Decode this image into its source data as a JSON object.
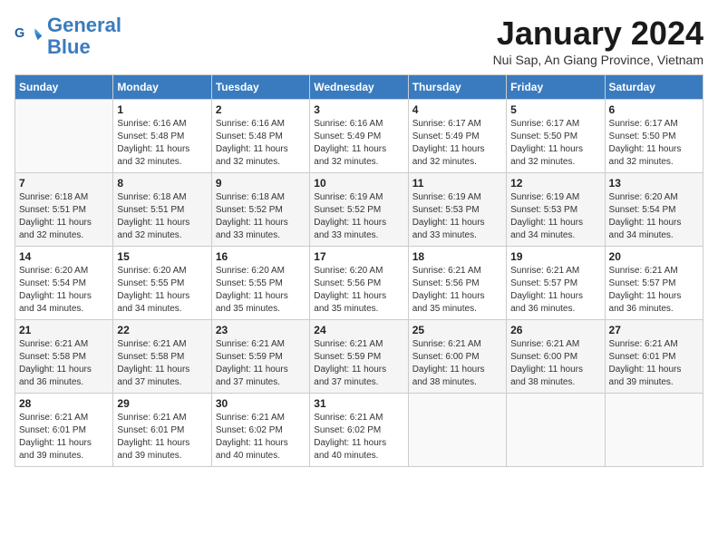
{
  "header": {
    "logo_line1": "General",
    "logo_line2": "Blue",
    "month_title": "January 2024",
    "location": "Nui Sap, An Giang Province, Vietnam"
  },
  "days_of_week": [
    "Sunday",
    "Monday",
    "Tuesday",
    "Wednesday",
    "Thursday",
    "Friday",
    "Saturday"
  ],
  "weeks": [
    [
      {
        "day": "",
        "info": ""
      },
      {
        "day": "1",
        "info": "Sunrise: 6:16 AM\nSunset: 5:48 PM\nDaylight: 11 hours\nand 32 minutes."
      },
      {
        "day": "2",
        "info": "Sunrise: 6:16 AM\nSunset: 5:48 PM\nDaylight: 11 hours\nand 32 minutes."
      },
      {
        "day": "3",
        "info": "Sunrise: 6:16 AM\nSunset: 5:49 PM\nDaylight: 11 hours\nand 32 minutes."
      },
      {
        "day": "4",
        "info": "Sunrise: 6:17 AM\nSunset: 5:49 PM\nDaylight: 11 hours\nand 32 minutes."
      },
      {
        "day": "5",
        "info": "Sunrise: 6:17 AM\nSunset: 5:50 PM\nDaylight: 11 hours\nand 32 minutes."
      },
      {
        "day": "6",
        "info": "Sunrise: 6:17 AM\nSunset: 5:50 PM\nDaylight: 11 hours\nand 32 minutes."
      }
    ],
    [
      {
        "day": "7",
        "info": "Sunrise: 6:18 AM\nSunset: 5:51 PM\nDaylight: 11 hours\nand 32 minutes."
      },
      {
        "day": "8",
        "info": "Sunrise: 6:18 AM\nSunset: 5:51 PM\nDaylight: 11 hours\nand 32 minutes."
      },
      {
        "day": "9",
        "info": "Sunrise: 6:18 AM\nSunset: 5:52 PM\nDaylight: 11 hours\nand 33 minutes."
      },
      {
        "day": "10",
        "info": "Sunrise: 6:19 AM\nSunset: 5:52 PM\nDaylight: 11 hours\nand 33 minutes."
      },
      {
        "day": "11",
        "info": "Sunrise: 6:19 AM\nSunset: 5:53 PM\nDaylight: 11 hours\nand 33 minutes."
      },
      {
        "day": "12",
        "info": "Sunrise: 6:19 AM\nSunset: 5:53 PM\nDaylight: 11 hours\nand 34 minutes."
      },
      {
        "day": "13",
        "info": "Sunrise: 6:20 AM\nSunset: 5:54 PM\nDaylight: 11 hours\nand 34 minutes."
      }
    ],
    [
      {
        "day": "14",
        "info": "Sunrise: 6:20 AM\nSunset: 5:54 PM\nDaylight: 11 hours\nand 34 minutes."
      },
      {
        "day": "15",
        "info": "Sunrise: 6:20 AM\nSunset: 5:55 PM\nDaylight: 11 hours\nand 34 minutes."
      },
      {
        "day": "16",
        "info": "Sunrise: 6:20 AM\nSunset: 5:55 PM\nDaylight: 11 hours\nand 35 minutes."
      },
      {
        "day": "17",
        "info": "Sunrise: 6:20 AM\nSunset: 5:56 PM\nDaylight: 11 hours\nand 35 minutes."
      },
      {
        "day": "18",
        "info": "Sunrise: 6:21 AM\nSunset: 5:56 PM\nDaylight: 11 hours\nand 35 minutes."
      },
      {
        "day": "19",
        "info": "Sunrise: 6:21 AM\nSunset: 5:57 PM\nDaylight: 11 hours\nand 36 minutes."
      },
      {
        "day": "20",
        "info": "Sunrise: 6:21 AM\nSunset: 5:57 PM\nDaylight: 11 hours\nand 36 minutes."
      }
    ],
    [
      {
        "day": "21",
        "info": "Sunrise: 6:21 AM\nSunset: 5:58 PM\nDaylight: 11 hours\nand 36 minutes."
      },
      {
        "day": "22",
        "info": "Sunrise: 6:21 AM\nSunset: 5:58 PM\nDaylight: 11 hours\nand 37 minutes."
      },
      {
        "day": "23",
        "info": "Sunrise: 6:21 AM\nSunset: 5:59 PM\nDaylight: 11 hours\nand 37 minutes."
      },
      {
        "day": "24",
        "info": "Sunrise: 6:21 AM\nSunset: 5:59 PM\nDaylight: 11 hours\nand 37 minutes."
      },
      {
        "day": "25",
        "info": "Sunrise: 6:21 AM\nSunset: 6:00 PM\nDaylight: 11 hours\nand 38 minutes."
      },
      {
        "day": "26",
        "info": "Sunrise: 6:21 AM\nSunset: 6:00 PM\nDaylight: 11 hours\nand 38 minutes."
      },
      {
        "day": "27",
        "info": "Sunrise: 6:21 AM\nSunset: 6:01 PM\nDaylight: 11 hours\nand 39 minutes."
      }
    ],
    [
      {
        "day": "28",
        "info": "Sunrise: 6:21 AM\nSunset: 6:01 PM\nDaylight: 11 hours\nand 39 minutes."
      },
      {
        "day": "29",
        "info": "Sunrise: 6:21 AM\nSunset: 6:01 PM\nDaylight: 11 hours\nand 39 minutes."
      },
      {
        "day": "30",
        "info": "Sunrise: 6:21 AM\nSunset: 6:02 PM\nDaylight: 11 hours\nand 40 minutes."
      },
      {
        "day": "31",
        "info": "Sunrise: 6:21 AM\nSunset: 6:02 PM\nDaylight: 11 hours\nand 40 minutes."
      },
      {
        "day": "",
        "info": ""
      },
      {
        "day": "",
        "info": ""
      },
      {
        "day": "",
        "info": ""
      }
    ]
  ]
}
